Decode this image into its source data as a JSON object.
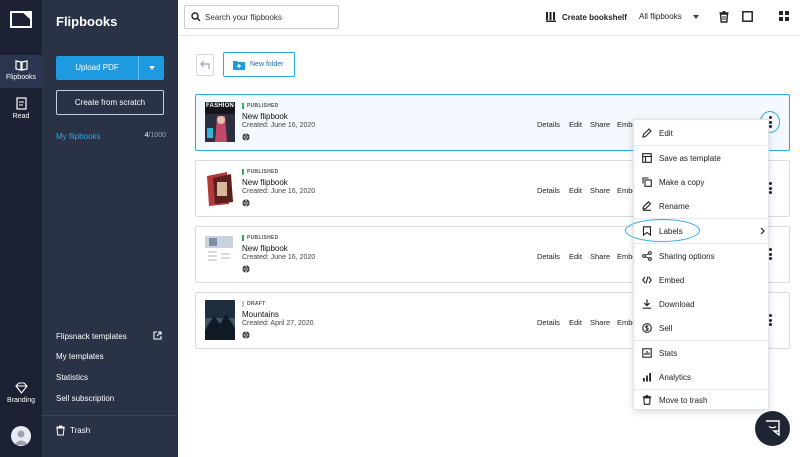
{
  "rail": {
    "items": [
      {
        "label": "Flipbooks",
        "icon": "book-open-icon",
        "active": true
      },
      {
        "label": "Read",
        "icon": "reader-icon",
        "active": false
      }
    ],
    "branding_label": "Branding"
  },
  "sidebar": {
    "title": "Flipbooks",
    "upload_label": "Upload PDF",
    "scratch_label": "Create from scratch",
    "my_flipbooks_label": "My flipbooks",
    "my_flipbooks_count": "4",
    "my_flipbooks_limit": "/1000",
    "bottom_links": [
      "Flipsnack templates",
      "My templates",
      "Statistics",
      "Sell subscription"
    ],
    "trash_label": "Trash"
  },
  "topbar": {
    "search_placeholder": "Search your flipbooks",
    "create_bookshelf_label": "Create bookshelf",
    "filter_label": "All flipbooks"
  },
  "toolbar": {
    "new_folder_label": "New folder"
  },
  "flipbooks": [
    {
      "status": "PUBLISHED",
      "title": "New flipbook",
      "created": "Created: June 16, 2020",
      "thumb_text": "FASHION",
      "selected": true
    },
    {
      "status": "PUBLISHED",
      "title": "New flipbook",
      "created": "Created: June 16, 2020",
      "selected": false
    },
    {
      "status": "PUBLISHED",
      "title": "New flipbook",
      "created": "Created: June 16, 2020",
      "selected": false
    },
    {
      "status": "DRAFT",
      "title": "Mountains",
      "created": "Created: April 27, 2020",
      "selected": false
    }
  ],
  "card_actions": [
    "Details",
    "Edit",
    "Share",
    "Embed"
  ],
  "menu": {
    "items": [
      {
        "label": "Edit",
        "icon": "pencil-icon"
      },
      {
        "label": "Save as template",
        "icon": "template-icon"
      },
      {
        "label": "Make a copy",
        "icon": "copy-icon"
      },
      {
        "label": "Rename",
        "icon": "rename-icon"
      },
      {
        "label": "Labels",
        "icon": "label-icon"
      },
      {
        "label": "Sharing options",
        "icon": "share-icon"
      },
      {
        "label": "Embed",
        "icon": "code-icon"
      },
      {
        "label": "Download",
        "icon": "download-icon"
      },
      {
        "label": "Sell",
        "icon": "dollar-icon"
      },
      {
        "label": "Stats",
        "icon": "bar-chart-icon"
      },
      {
        "label": "Analytics",
        "icon": "analytics-icon"
      },
      {
        "label": "Move to trash",
        "icon": "trash-icon"
      }
    ]
  },
  "colors": {
    "accent": "#1e9ae0",
    "rail": "#1c2234",
    "sidebar": "#2a3246",
    "published": "#2db24e"
  }
}
